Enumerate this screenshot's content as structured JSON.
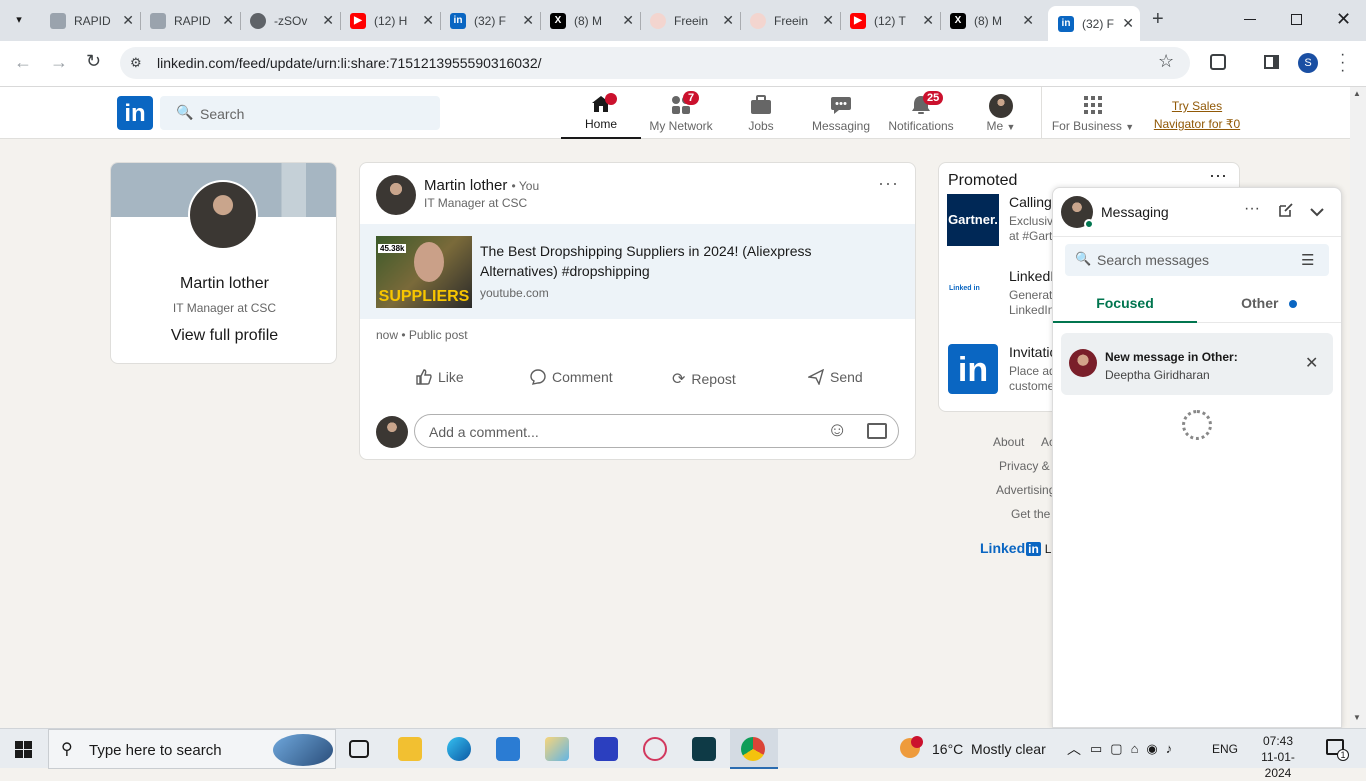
{
  "browser": {
    "tabs": [
      {
        "label": "RAPID",
        "icon": "rapid-icon"
      },
      {
        "label": "RAPID",
        "icon": "rapid-icon"
      },
      {
        "label": "-zSOv",
        "icon": "globe-icon"
      },
      {
        "label": "(12) H",
        "icon": "youtube-icon"
      },
      {
        "label": "(32) F",
        "icon": "linkedin-icon"
      },
      {
        "label": "(8) M",
        "icon": "x-icon"
      },
      {
        "label": "Freein",
        "icon": "freein-icon"
      },
      {
        "label": "Freein",
        "icon": "freein-icon"
      },
      {
        "label": "(12) T",
        "icon": "youtube-icon"
      },
      {
        "label": "(8) M",
        "icon": "x-icon"
      },
      {
        "label": "(32) F",
        "icon": "linkedin-icon"
      }
    ],
    "url": "linkedin.com/feed/update/urn:li:share:7151213955590316032/",
    "profile_initial": "S"
  },
  "nav": {
    "search_placeholder": "Search",
    "home": "Home",
    "network": "My Network",
    "network_badge": "7",
    "jobs": "Jobs",
    "messaging": "Messaging",
    "notifications": "Notifications",
    "notifications_badge": "25",
    "me": "Me",
    "business": "For Business",
    "sales_line1": "Try Sales",
    "sales_line2": "Navigator for ₹0"
  },
  "profile": {
    "name": "Martin lother",
    "headline": "IT Manager at CSC",
    "view_profile": "View full profile"
  },
  "post": {
    "author": "Martin lother",
    "you": "• You",
    "headline": "IT Manager at CSC",
    "link_title": "The Best Dropshipping Suppliers in 2024! (Aliexpress Alternatives) #dropshipping",
    "link_domain": "youtube.com",
    "thumb_text": "SUPPLIERS",
    "thumb_stat": "45.38k",
    "meta": "now • Public post",
    "like": "Like",
    "comment": "Comment",
    "repost": "Repost",
    "send": "Send",
    "comment_placeholder": "Add a comment..."
  },
  "promoted": {
    "title": "Promoted",
    "items": [
      {
        "logo": "Gartner.",
        "title": "Calling",
        "line1": "Exclusiv",
        "line2": "at #Gart"
      },
      {
        "logo": "Linked in",
        "title": "LinkedI",
        "line1": "Generate",
        "line2": "LinkedIn"
      },
      {
        "logo": "in",
        "title": "Invitatio",
        "line1": "Place ad",
        "line2": "custome"
      }
    ]
  },
  "footer": {
    "about": "About",
    "ac": "Ac",
    "privacy": "Privacy &",
    "advertising": "Advertising",
    "get": "Get the",
    "brand": "Linked",
    "brand_in": "in",
    "brand_rest": "Li"
  },
  "messaging": {
    "title": "Messaging",
    "search_placeholder": "Search messages",
    "tab_focused": "Focused",
    "tab_other": "Other",
    "notice_title": "New message in Other:",
    "notice_sender": "Deeptha Giridharan"
  },
  "taskbar": {
    "search_placeholder": "Type here to search",
    "weather": "16°C  Mostly clear",
    "lang": "ENG",
    "time": "07:43",
    "date": "11-01-2024",
    "notif_count": "1"
  },
  "colors": {
    "linkedin_blue": "#0a66c2",
    "badge_red": "#cb112d",
    "focused_green": "#01754f"
  }
}
